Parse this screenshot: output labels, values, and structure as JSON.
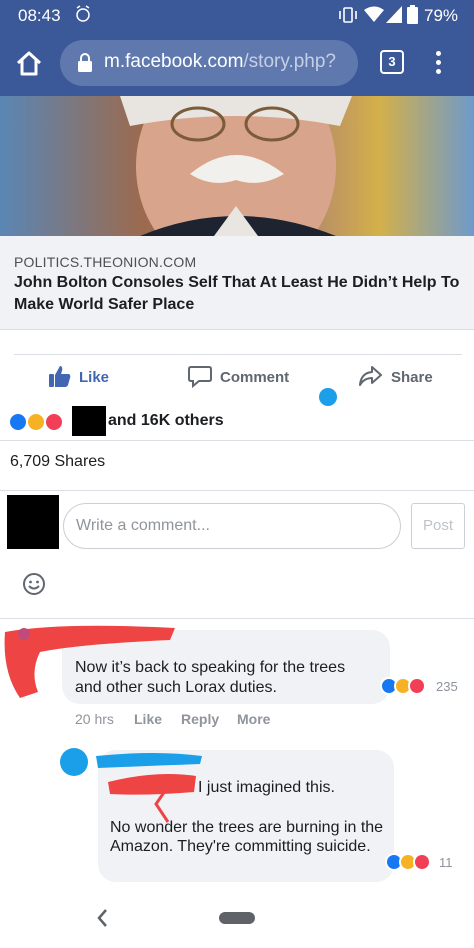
{
  "status_bar": {
    "time": "08:43",
    "battery": "79%"
  },
  "browser": {
    "url_domain": "m.facebook.com",
    "url_path": "/story.php?",
    "tab_count": "3"
  },
  "link_preview": {
    "domain": "POLITICS.THEONION.COM",
    "title": "John Bolton Consoles Self That At Least He Didn’t Help To Make World Safer Place"
  },
  "actions": {
    "like": "Like",
    "comment": "Comment",
    "share": "Share"
  },
  "reactions": {
    "summary": "and 16K others",
    "types": [
      "like-icon",
      "haha-icon",
      "love-icon"
    ]
  },
  "shares": "6,709 Shares",
  "composer": {
    "placeholder": "Write a comment...",
    "post_label": "Post"
  },
  "comments": [
    {
      "text": "Now it’s back to speaking for the trees and other such Lorax duties.",
      "reaction_count": "235",
      "time": "20 hrs",
      "like_label": "Like",
      "reply_label": "Reply",
      "more_label": "More"
    },
    {
      "text_line1": "I just imagined this.",
      "text": "No wonder the trees are burning in the Amazon. They're committing suicide.",
      "reaction_count": "11"
    }
  ],
  "colors": {
    "facebook_blue": "#3b5998",
    "like_blue": "#4267b2",
    "bubble_bg": "#f0f2f5",
    "redaction_red": "#ee4444",
    "redaction_blue": "#1a9fe8"
  }
}
